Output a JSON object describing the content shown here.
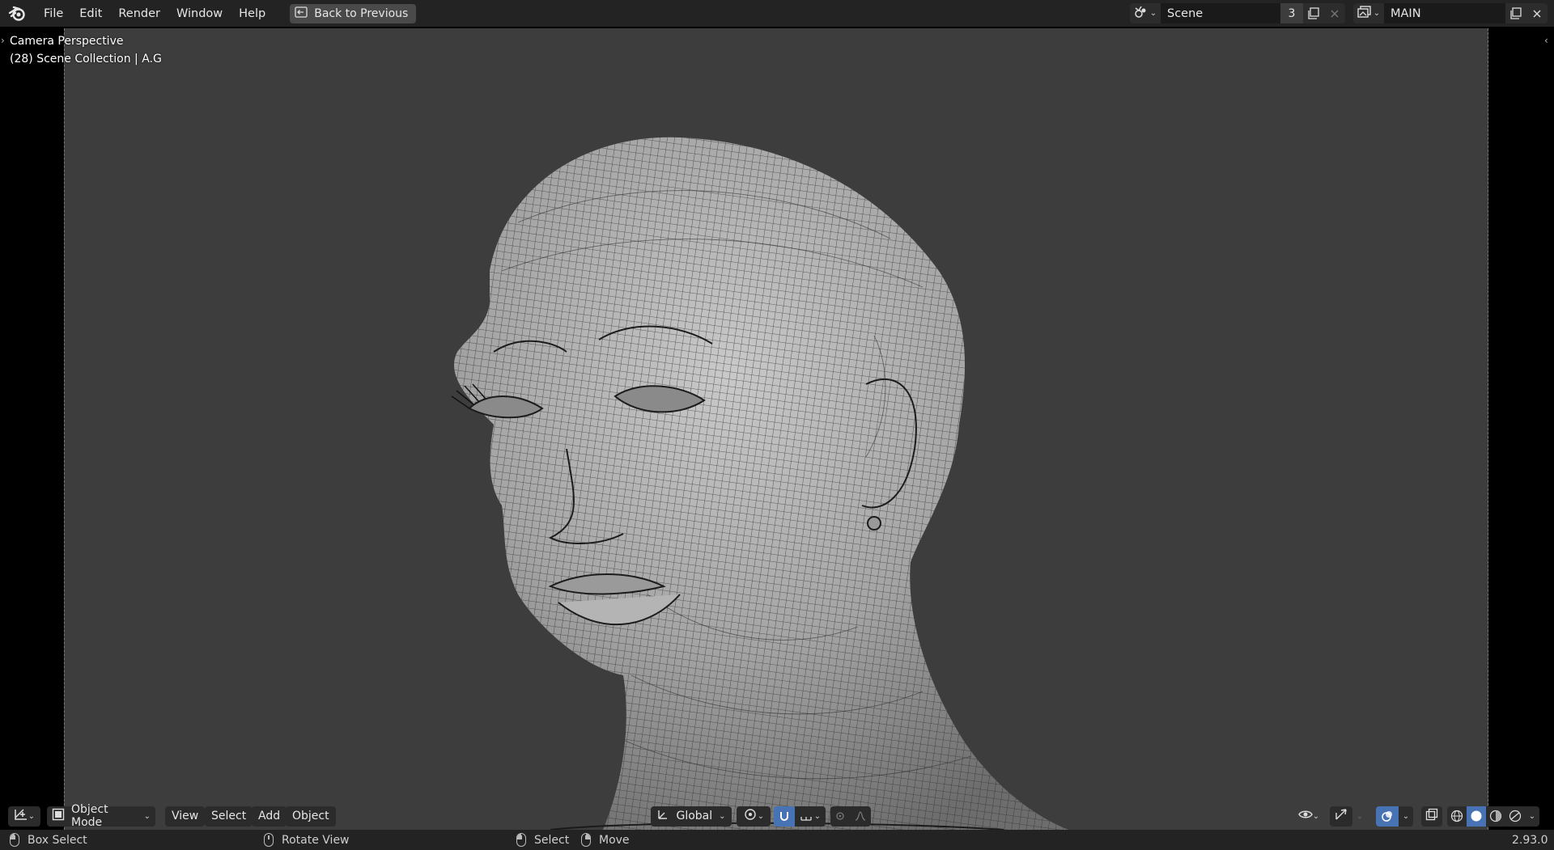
{
  "menubar": {
    "items": [
      "File",
      "Edit",
      "Render",
      "Window",
      "Help"
    ],
    "back_button": "Back to Previous"
  },
  "scene_selector": {
    "name": "Scene",
    "users": "3"
  },
  "view_layer_selector": {
    "name": "MAIN"
  },
  "viewport": {
    "overlay_line1": "Camera Perspective",
    "overlay_line2": "(28) Scene Collection | A.G"
  },
  "viewport_header": {
    "mode": "Object Mode",
    "menus": [
      "View",
      "Select",
      "Add",
      "Object"
    ],
    "orientation": "Global"
  },
  "statusbar": {
    "box_select": "Box Select",
    "rotate_view": "Rotate View",
    "select": "Select",
    "move": "Move",
    "version": "2.93.0"
  },
  "colors": {
    "accent": "#4772b3",
    "viewport_bg": "#3d3d3d",
    "header_bg": "#232323"
  },
  "icons": [
    "blender-logo-icon",
    "back-icon",
    "scene-icon",
    "new-scene-icon",
    "close-icon",
    "view-layer-icon",
    "editor-type-icon",
    "object-mode-icon",
    "transform-orientation-icon",
    "pivot-icon",
    "snap-icon",
    "snap-increment-icon",
    "proportional-edit-icon",
    "visibility-icon",
    "gizmo-icon",
    "overlay-icon",
    "xray-icon",
    "wireframe-shading-icon",
    "solid-shading-icon",
    "material-shading-icon",
    "rendered-shading-icon"
  ]
}
